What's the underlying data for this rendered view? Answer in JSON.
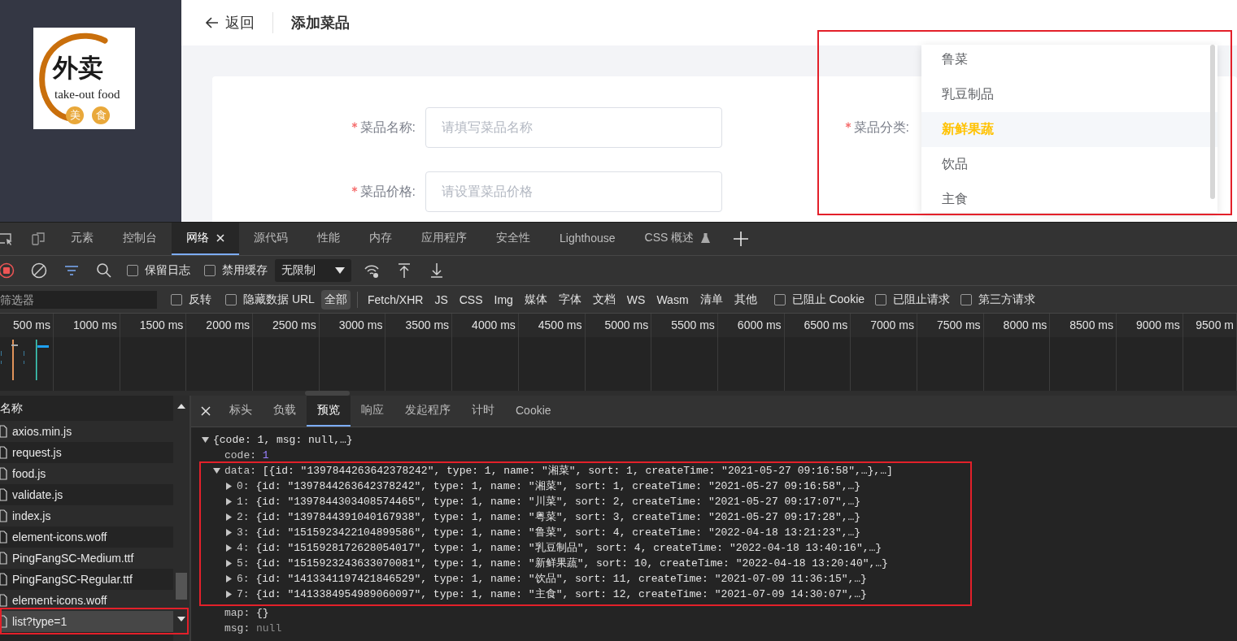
{
  "sidebar": {
    "logo": {
      "title": "外卖",
      "subtitle": "take-out food",
      "badges": [
        "美",
        "食"
      ]
    }
  },
  "header": {
    "back": "返回",
    "title": "添加菜品"
  },
  "form": {
    "fields": [
      {
        "label": "菜品名称:",
        "required": true,
        "placeholder": "请填写菜品名称"
      },
      {
        "label": "菜品价格:",
        "required": true,
        "placeholder": "请设置菜品价格"
      }
    ],
    "category": {
      "label": "菜品分类:",
      "required": true,
      "highlight": true,
      "options": [
        {
          "label": "鲁菜",
          "selected": false
        },
        {
          "label": "乳豆制品",
          "selected": false
        },
        {
          "label": "新鲜果蔬",
          "selected": true
        },
        {
          "label": "饮品",
          "selected": false
        },
        {
          "label": "主食",
          "selected": false
        }
      ]
    }
  },
  "devtools": {
    "tabs": [
      {
        "label": "元素",
        "selected": false
      },
      {
        "label": "控制台",
        "selected": false
      },
      {
        "label": "网络",
        "selected": true,
        "closable": true
      },
      {
        "label": "源代码",
        "selected": false
      },
      {
        "label": "性能",
        "selected": false
      },
      {
        "label": "内存",
        "selected": false
      },
      {
        "label": "应用程序",
        "selected": false
      },
      {
        "label": "安全性",
        "selected": false
      },
      {
        "label": "Lighthouse",
        "selected": false
      },
      {
        "label": "CSS 概述",
        "selected": false,
        "experimental": true
      }
    ],
    "toolbar": {
      "recording": true,
      "options": [
        {
          "label": "保留日志",
          "checked": false
        },
        {
          "label": "禁用缓存",
          "checked": false
        }
      ],
      "throttle": "无限制"
    },
    "filter": {
      "placeholder": "筛选器",
      "options": [
        {
          "label": "反转",
          "checked": false
        },
        {
          "label": "隐藏数据 URL",
          "checked": false
        }
      ],
      "types": [
        {
          "label": "全部",
          "selected": true
        },
        {
          "label": "Fetch/XHR",
          "selected": false
        },
        {
          "label": "JS",
          "selected": false
        },
        {
          "label": "CSS",
          "selected": false
        },
        {
          "label": "Img",
          "selected": false
        },
        {
          "label": "媒体",
          "selected": false
        },
        {
          "label": "字体",
          "selected": false
        },
        {
          "label": "文档",
          "selected": false
        },
        {
          "label": "WS",
          "selected": false
        },
        {
          "label": "Wasm",
          "selected": false
        },
        {
          "label": "清单",
          "selected": false
        },
        {
          "label": "其他",
          "selected": false
        }
      ],
      "more_options": [
        {
          "label": "已阻止 Cookie",
          "checked": false
        },
        {
          "label": "已阻止请求",
          "checked": false
        },
        {
          "label": "第三方请求",
          "checked": false
        }
      ]
    },
    "timeline": {
      "ticks": [
        "500 ms",
        "1000 ms",
        "1500 ms",
        "2000 ms",
        "2500 ms",
        "3000 ms",
        "3500 ms",
        "4000 ms",
        "4500 ms",
        "5000 ms",
        "5500 ms",
        "6000 ms",
        "6500 ms",
        "7000 ms",
        "7500 ms",
        "8000 ms",
        "8500 ms",
        "9000 ms",
        "9500 m"
      ]
    },
    "requests": {
      "header": "名称",
      "items": [
        {
          "name": "axios.min.js",
          "selected": false
        },
        {
          "name": "request.js",
          "selected": false
        },
        {
          "name": "food.js",
          "selected": false
        },
        {
          "name": "validate.js",
          "selected": false
        },
        {
          "name": "index.js",
          "selected": false
        },
        {
          "name": "element-icons.woff",
          "selected": false
        },
        {
          "name": "PingFangSC-Medium.ttf",
          "selected": false
        },
        {
          "name": "PingFangSC-Regular.ttf",
          "selected": false
        },
        {
          "name": "element-icons.woff",
          "selected": false
        },
        {
          "name": "list?type=1",
          "selected": true,
          "highlight": true
        }
      ]
    },
    "detail": {
      "tabs": [
        {
          "label": "标头",
          "selected": false
        },
        {
          "label": "负载",
          "selected": false
        },
        {
          "label": "预览",
          "selected": true
        },
        {
          "label": "响应",
          "selected": false
        },
        {
          "label": "发起程序",
          "selected": false
        },
        {
          "label": "计时",
          "selected": false
        },
        {
          "label": "Cookie",
          "selected": false
        }
      ],
      "preview": {
        "root": {
          "expanded": true,
          "value": "{code: 1, msg: null,…}"
        },
        "properties": [
          {
            "key": "code:",
            "kind": "number",
            "value": "1"
          },
          {
            "key": "data:",
            "expanded": true,
            "highlight": true,
            "value": "[{id: \"1397844263642378242\", type: 1, name: \"湘菜\", sort: 1, createTime: \"2021-05-27 09:16:58\",…},…]",
            "children": [
              {
                "key": "0:",
                "expanded": false,
                "value": "{id: \"1397844263642378242\", type: 1, name: \"湘菜\", sort: 1, createTime: \"2021-05-27 09:16:58\",…}"
              },
              {
                "key": "1:",
                "expanded": false,
                "value": "{id: \"1397844303408574465\", type: 1, name: \"川菜\", sort: 2, createTime: \"2021-05-27 09:17:07\",…}"
              },
              {
                "key": "2:",
                "expanded": false,
                "value": "{id: \"1397844391040167938\", type: 1, name: \"粤菜\", sort: 3, createTime: \"2021-05-27 09:17:28\",…}"
              },
              {
                "key": "3:",
                "expanded": false,
                "value": "{id: \"1515923422104899586\", type: 1, name: \"鲁菜\", sort: 4, createTime: \"2022-04-18 13:21:23\",…}"
              },
              {
                "key": "4:",
                "expanded": false,
                "value": "{id: \"1515928172628054017\", type: 1, name: \"乳豆制品\", sort: 4, createTime: \"2022-04-18 13:40:16\",…}"
              },
              {
                "key": "5:",
                "expanded": false,
                "value": "{id: \"1515923243633070081\", type: 1, name: \"新鲜果蔬\", sort: 10, createTime: \"2022-04-18 13:20:40\",…}"
              },
              {
                "key": "6:",
                "expanded": false,
                "value": "{id: \"1413341197421846529\", type: 1, name: \"饮品\", sort: 11, createTime: \"2021-07-09 11:36:15\",…}"
              },
              {
                "key": "7:",
                "expanded": false,
                "value": "{id: \"1413384954989060097\", type: 1, name: \"主食\", sort: 12, createTime: \"2021-07-09 14:30:07\",…}"
              }
            ]
          },
          {
            "key": "map:",
            "value": "{}"
          },
          {
            "key": "msg:",
            "kind": "null",
            "value": "null"
          }
        ]
      }
    }
  }
}
